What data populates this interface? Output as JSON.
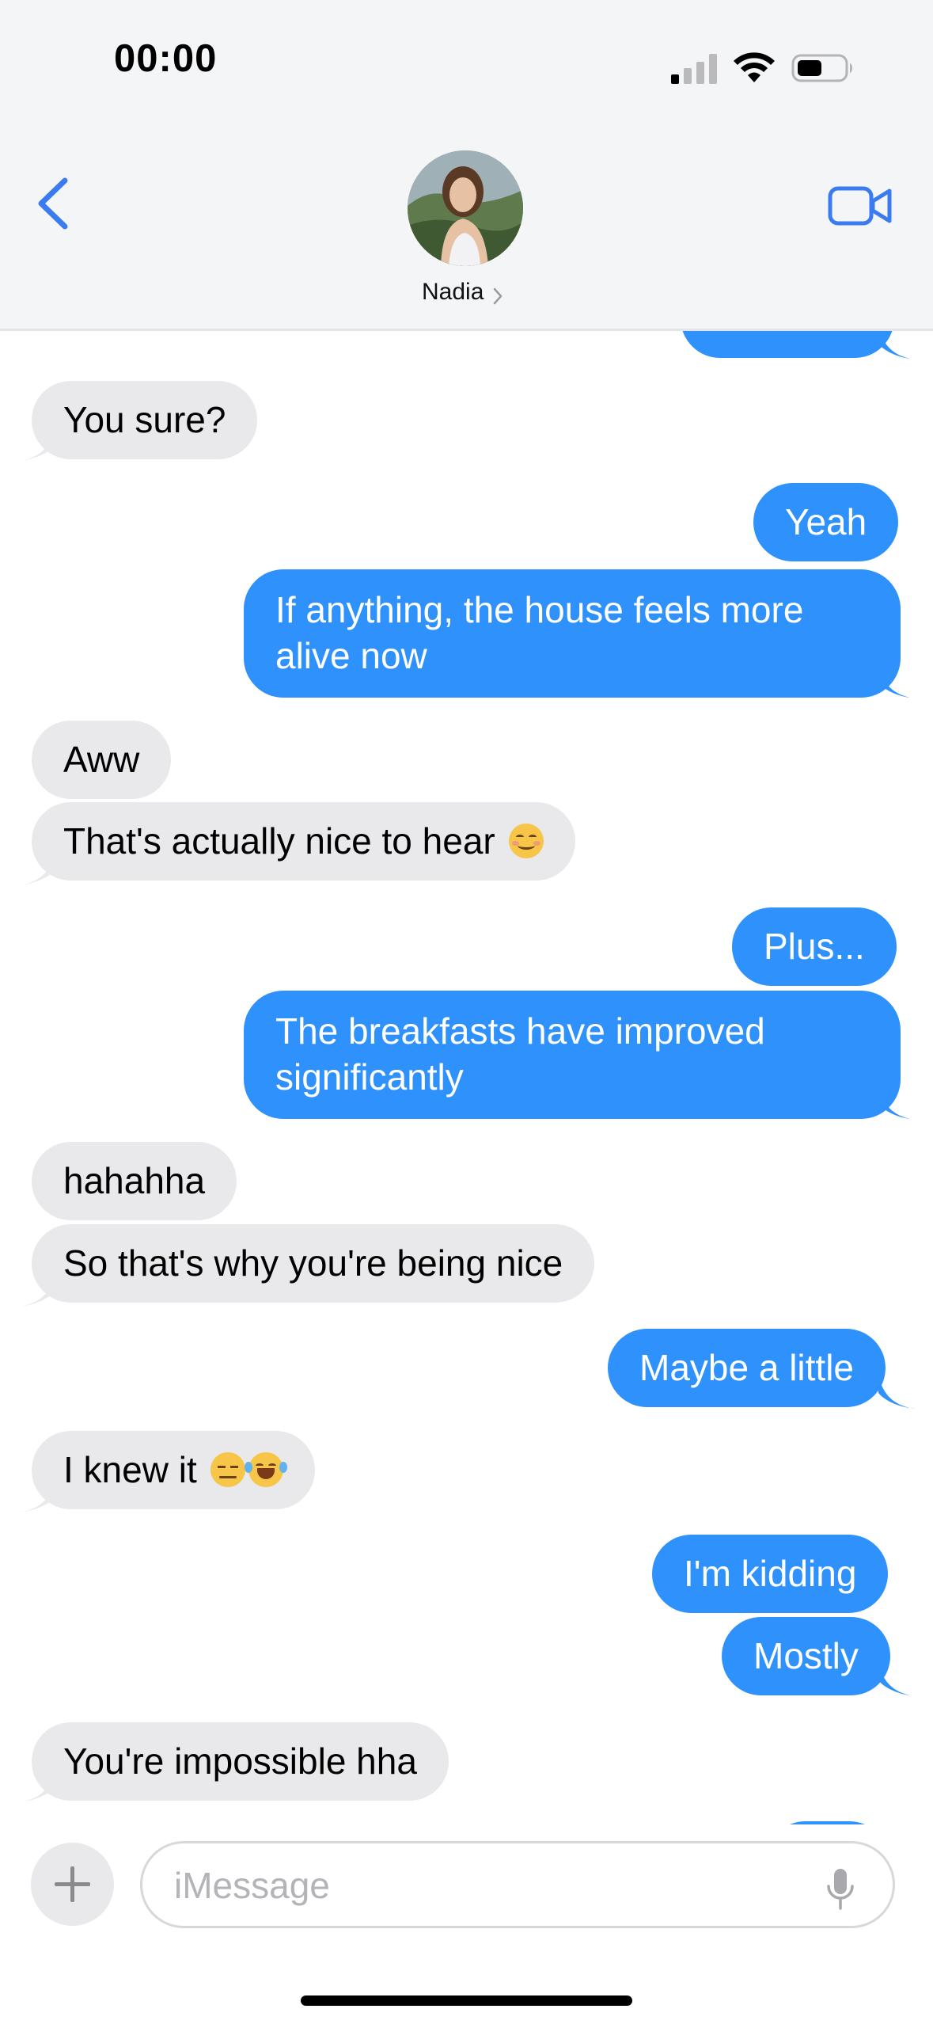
{
  "status_bar": {
    "time": "00:00"
  },
  "header": {
    "contact_name": "Nadia"
  },
  "colors": {
    "accent": "#2f91fb",
    "incoming_bubble": "#e9e9eb",
    "ios_blue": "#3a7bf0"
  },
  "messages": [
    {
      "direction": "outgoing",
      "text": ""
    },
    {
      "direction": "incoming",
      "text": "You sure?"
    },
    {
      "direction": "outgoing",
      "text": "Yeah"
    },
    {
      "direction": "outgoing",
      "text": "If anything, the house feels more alive now"
    },
    {
      "direction": "incoming",
      "text": "Aww"
    },
    {
      "direction": "incoming",
      "text": "That's actually nice to hear",
      "emoji": [
        "smiling-face-icon"
      ]
    },
    {
      "direction": "outgoing",
      "text": "Plus..."
    },
    {
      "direction": "outgoing",
      "text": "The breakfasts have improved significantly"
    },
    {
      "direction": "incoming",
      "text": "hahahha"
    },
    {
      "direction": "incoming",
      "text": "So that's why you're being nice"
    },
    {
      "direction": "outgoing",
      "text": "Maybe a little"
    },
    {
      "direction": "incoming",
      "text": "I knew it",
      "emoji": [
        "unamused-face-icon",
        "tears-of-joy-icon"
      ]
    },
    {
      "direction": "outgoing",
      "text": "I'm kidding"
    },
    {
      "direction": "outgoing",
      "text": "Mostly"
    },
    {
      "direction": "incoming",
      "text": "You're impossible hha"
    }
  ],
  "composer": {
    "placeholder": "iMessage",
    "value": ""
  },
  "icons": {
    "back": "chevron-left-icon",
    "video": "video-camera-icon",
    "add": "plus-icon",
    "dictation": "microphone-icon"
  }
}
